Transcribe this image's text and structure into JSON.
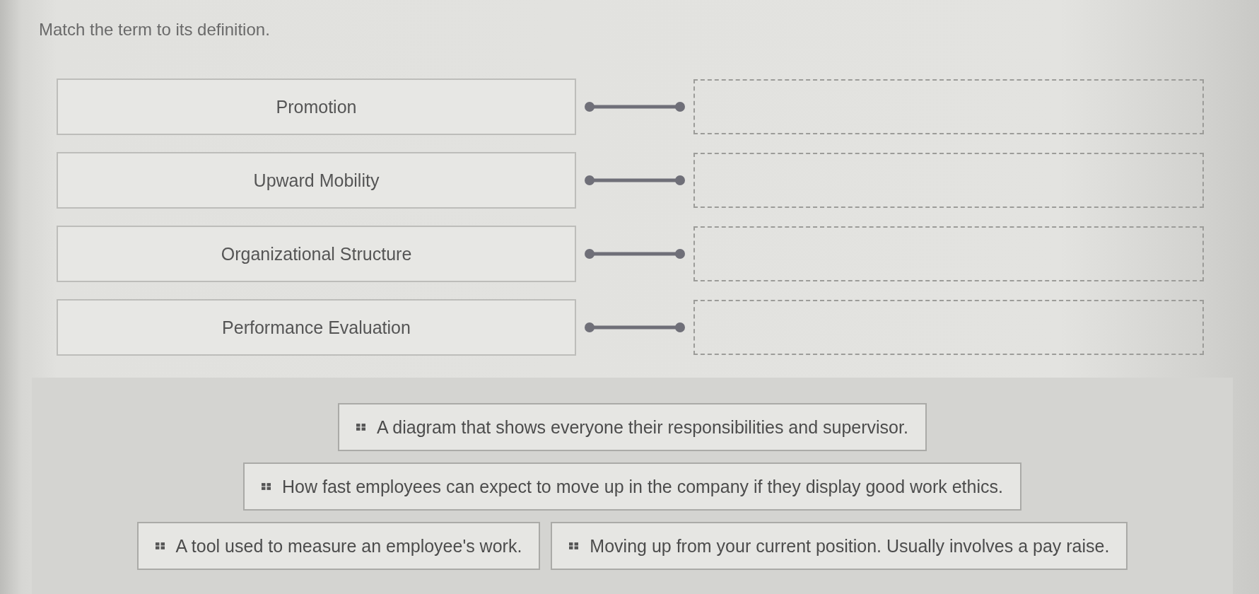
{
  "instruction": "Match the term to its definition.",
  "terms": [
    {
      "label": "Promotion"
    },
    {
      "label": "Upward Mobility"
    },
    {
      "label": "Organizational Structure"
    },
    {
      "label": "Performance Evaluation"
    }
  ],
  "definitions": [
    {
      "text": "A diagram that shows everyone their responsibilities and supervisor."
    },
    {
      "text": "How fast employees can expect to move up in the company if they display good work ethics."
    },
    {
      "text": "A tool used to measure an employee's work."
    },
    {
      "text": "Moving up from your current position. Usually involves a pay raise."
    }
  ]
}
